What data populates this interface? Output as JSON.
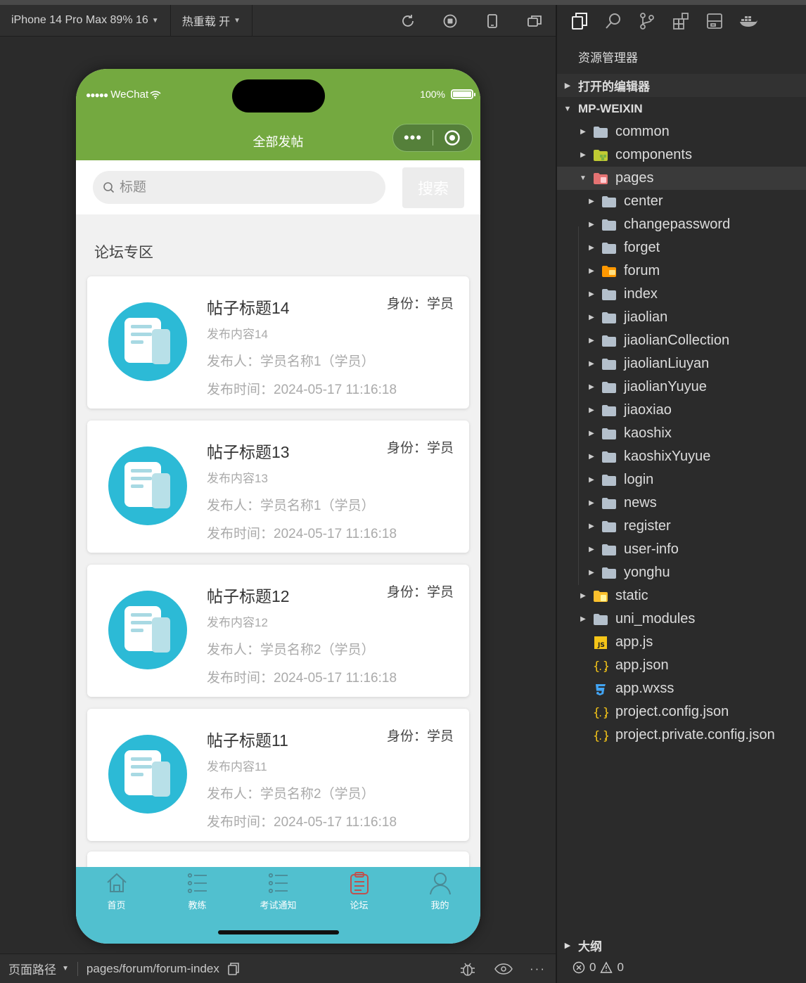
{
  "toolbar": {
    "device": "iPhone 14 Pro Max 89% 16",
    "hot_reload": "热重载 开"
  },
  "phone": {
    "carrier": "WeChat",
    "battery": "100%",
    "nav_title": "全部发帖",
    "search": {
      "placeholder": "标题",
      "button": "搜索"
    },
    "section_title": "论坛专区",
    "posts": [
      {
        "title": "帖子标题14",
        "role": "身份：学员",
        "content": "发布内容14",
        "author": "发布人：学员名称1（学员）",
        "time": "发布时间：2024-05-17 11:16:18"
      },
      {
        "title": "帖子标题13",
        "role": "身份：学员",
        "content": "发布内容13",
        "author": "发布人：学员名称1（学员）",
        "time": "发布时间：2024-05-17 11:16:18"
      },
      {
        "title": "帖子标题12",
        "role": "身份：学员",
        "content": "发布内容12",
        "author": "发布人：学员名称2（学员）",
        "time": "发布时间：2024-05-17 11:16:18"
      },
      {
        "title": "帖子标题11",
        "role": "身份：学员",
        "content": "发布内容11",
        "author": "发布人：学员名称2（学员）",
        "time": "发布时间：2024-05-17 11:16:18"
      }
    ],
    "tabs": [
      {
        "label": "首页",
        "icon": "home-icon"
      },
      {
        "label": "教练",
        "icon": "list-icon"
      },
      {
        "label": "考试通知",
        "icon": "list-icon"
      },
      {
        "label": "论坛",
        "icon": "clipboard-icon",
        "active": true
      },
      {
        "label": "我的",
        "icon": "user-icon"
      }
    ],
    "colors": {
      "nav": "#74a940",
      "tabbar": "#51c0cf",
      "active_tab": "#c0504d",
      "avatar": "#2cbad6"
    }
  },
  "bottom_bar": {
    "path_label": "页面路径",
    "path": "pages/forum/forum-index"
  },
  "explorer": {
    "title": "资源管理器",
    "open_editors": "打开的编辑器",
    "project": "MP-WEIXIN",
    "tree": [
      {
        "name": "common",
        "type": "folder"
      },
      {
        "name": "components",
        "type": "folder-components"
      },
      {
        "name": "pages",
        "type": "folder-pages",
        "expanded": true
      },
      {
        "name": "center",
        "type": "folder"
      },
      {
        "name": "changepassword",
        "type": "folder"
      },
      {
        "name": "forget",
        "type": "folder"
      },
      {
        "name": "forum",
        "type": "folder-forum"
      },
      {
        "name": "index",
        "type": "folder"
      },
      {
        "name": "jiaolian",
        "type": "folder"
      },
      {
        "name": "jiaolianCollection",
        "type": "folder"
      },
      {
        "name": "jiaolianLiuyan",
        "type": "folder"
      },
      {
        "name": "jiaolianYuyue",
        "type": "folder"
      },
      {
        "name": "jiaoxiao",
        "type": "folder"
      },
      {
        "name": "kaoshix",
        "type": "folder"
      },
      {
        "name": "kaoshixYuyue",
        "type": "folder"
      },
      {
        "name": "login",
        "type": "folder"
      },
      {
        "name": "news",
        "type": "folder"
      },
      {
        "name": "register",
        "type": "folder"
      },
      {
        "name": "user-info",
        "type": "folder"
      },
      {
        "name": "yonghu",
        "type": "folder"
      },
      {
        "name": "static",
        "type": "folder-static"
      },
      {
        "name": "uni_modules",
        "type": "folder"
      },
      {
        "name": "app.js",
        "type": "js"
      },
      {
        "name": "app.json",
        "type": "json"
      },
      {
        "name": "app.wxss",
        "type": "css"
      },
      {
        "name": "project.config.json",
        "type": "json"
      },
      {
        "name": "project.private.config.json",
        "type": "json"
      }
    ],
    "outline": "大纲",
    "errors": "0",
    "warnings": "0"
  }
}
